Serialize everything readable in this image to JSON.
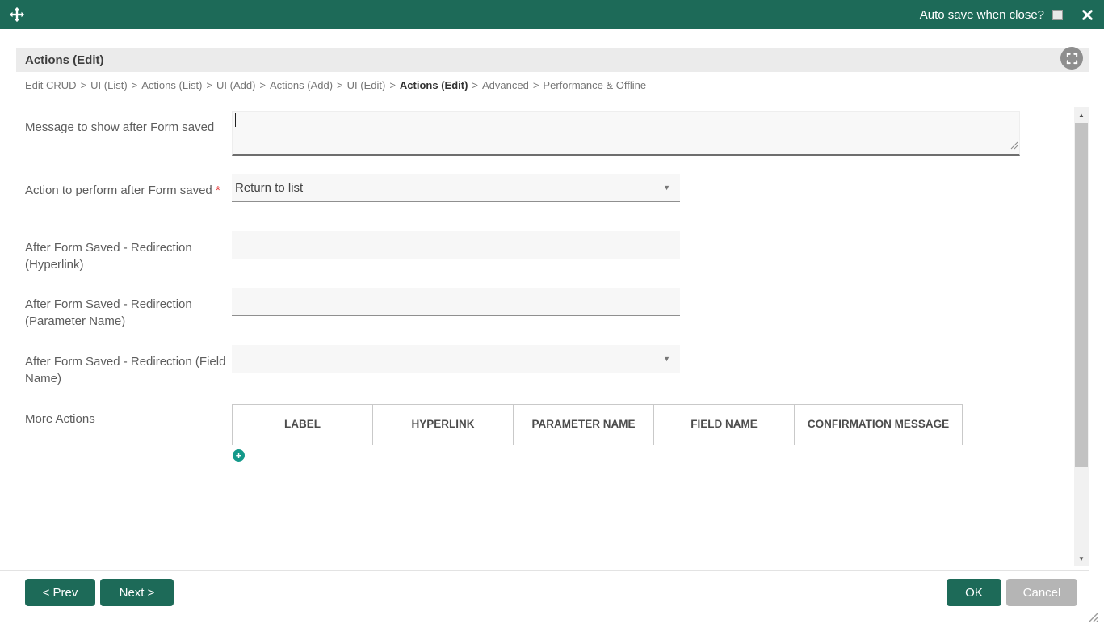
{
  "titlebar": {
    "autosave_label": "Auto save when close?",
    "autosave_checked": false,
    "icons": {
      "move": "✥",
      "close": "✕"
    }
  },
  "panel": {
    "title": "Actions (Edit)",
    "icons": {
      "expand": "⛶"
    }
  },
  "breadcrumb": {
    "separator": ">",
    "active_item": "Actions (Edit)",
    "items": [
      "Edit CRUD",
      "UI (List)",
      "Actions (List)",
      "UI (Add)",
      "Actions (Add)",
      "UI (Edit)",
      "Actions (Edit)",
      "Advanced",
      "Performance & Offline"
    ]
  },
  "form": {
    "required_marker": "*",
    "fields": [
      {
        "label": "Message to show after Form saved",
        "type": "textarea",
        "value": ""
      },
      {
        "label": "Action to perform after Form saved",
        "required": true,
        "type": "select",
        "value": "Return to list"
      },
      {
        "label": "After Form Saved - Redirection (Hyperlink)",
        "type": "text",
        "value": ""
      },
      {
        "label": "After Form Saved - Redirection (Parameter Name)",
        "type": "text",
        "value": ""
      },
      {
        "label": "After Form Saved - Redirection (Field Name)",
        "type": "select",
        "value": ""
      },
      {
        "label": "More Actions",
        "type": "table"
      }
    ],
    "more_actions_table": {
      "headers": [
        "LABEL",
        "HYPERLINK",
        "PARAMETER NAME",
        "FIELD NAME",
        "CONFIRMATION MESSAGE"
      ],
      "rows": []
    },
    "icons": {
      "add_row": "+",
      "select_arrow": "▼"
    }
  },
  "scrollbar": {
    "icons": {
      "up": "▲",
      "down": "▼"
    }
  },
  "footer": {
    "prev_label": "< Prev",
    "next_label": "Next >",
    "ok_label": "OK",
    "cancel_label": "Cancel"
  },
  "colors": {
    "accent_teal": "#1d6a58",
    "add_button_teal": "#14998a",
    "cancel_gray": "#b5b5b5",
    "header_gray": "#ebebeb",
    "required_red": "#e03030"
  }
}
